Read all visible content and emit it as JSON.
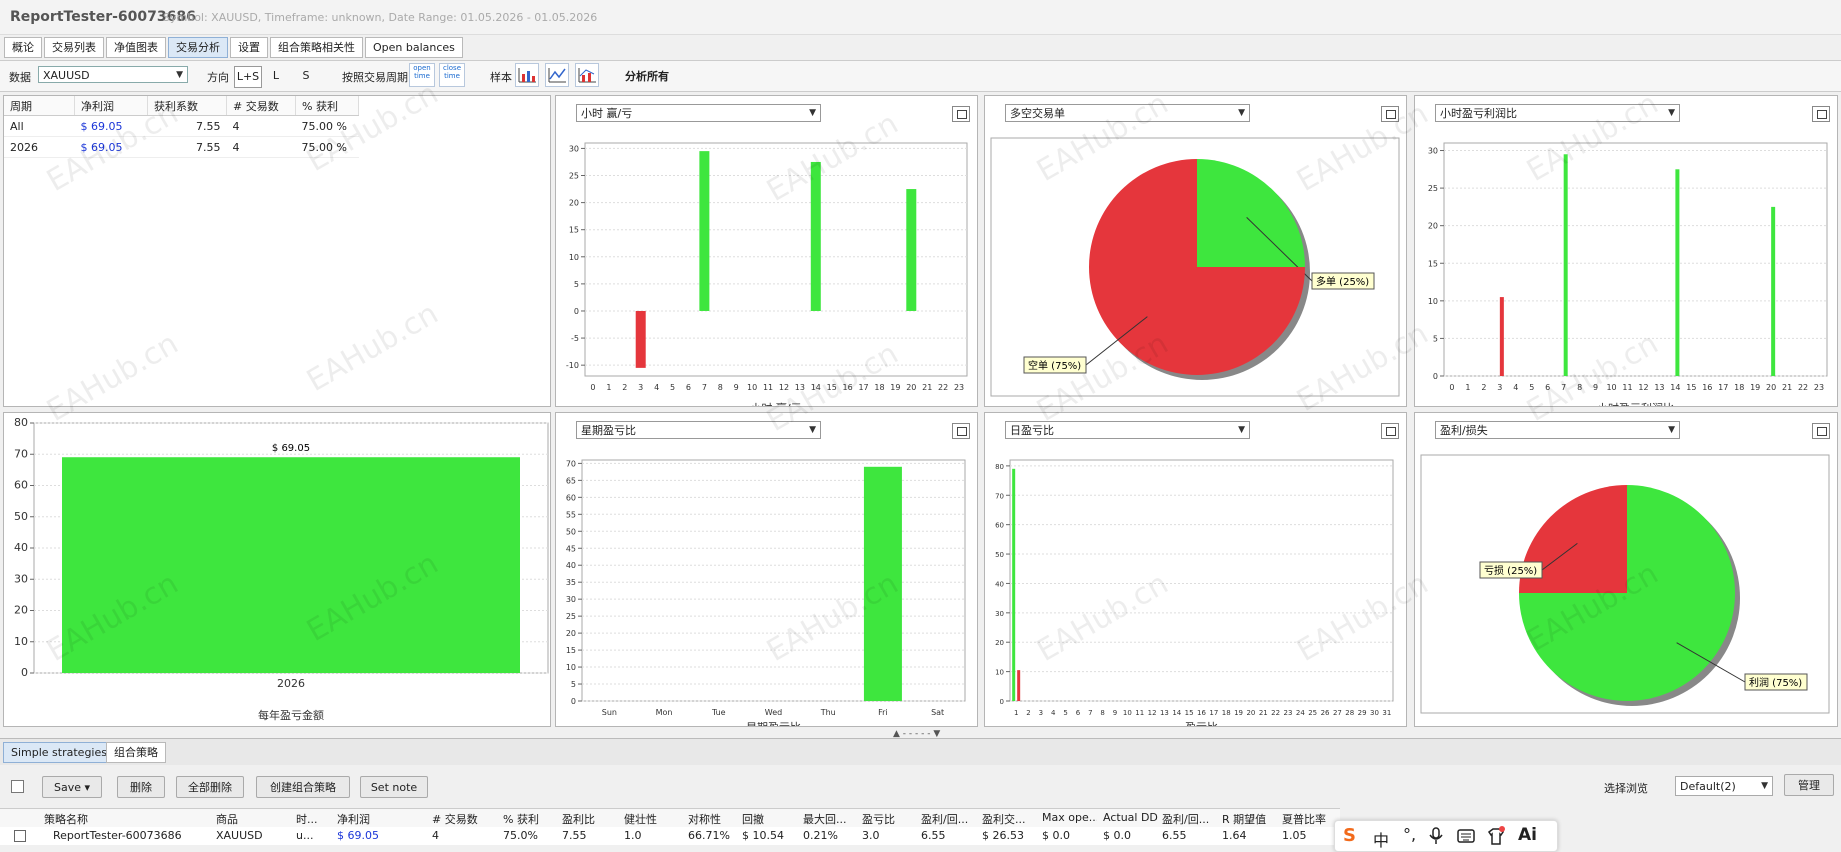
{
  "window": {
    "app_title": "ReportTester-60073686",
    "subtitle": "Symbol: XAUUSD, Timeframe: unknown, Date Range: 01.05.2026 - 01.05.2026"
  },
  "tabs": [
    "概论",
    "交易列表",
    "净值图表",
    "交易分析",
    "设置",
    "组合策略相关性",
    "Open balances"
  ],
  "active_tab": 3,
  "toolbar": {
    "data_label": "数据",
    "data_value": "XAUUSD",
    "direction_label": "方向",
    "dir_ls": "L+S",
    "dir_l": "L",
    "dir_s": "S",
    "by_period_label": "按照交易周期",
    "open_time": "open time",
    "close_time": "close time",
    "sample_label": "样本",
    "analyze_all": "分析所有"
  },
  "stats": {
    "headers": [
      "周期",
      "净利润",
      "获利系数",
      "# 交易数",
      "% 获利"
    ],
    "rows": [
      [
        "All",
        "$ 69.05",
        "7.55",
        "4",
        "75.00 %"
      ],
      [
        "2026",
        "$ 69.05",
        "7.55",
        "4",
        "75.00 %"
      ]
    ]
  },
  "panels": {
    "hourly_select": "小时 赢/亏",
    "long_short_select": "多空交易单",
    "hourly_pl_select": "小时盈亏利润比",
    "weekday_select": "星期盈亏比",
    "daily_select": "日盈亏比",
    "pl_select": "盈利/损失",
    "hourly_xlabel": "小时 赢/亏",
    "hourly_pl_xlabel": "小时盈亏利润比",
    "yearly_xlabel": "每年盈亏金额",
    "weekday_xlabel": "星期盈亏比",
    "daily_xlabel": "盈亏比"
  },
  "colors": {
    "green": "#3ee63e",
    "red": "#e5363c"
  },
  "chart_data": [
    {
      "type": "bar",
      "id": "hourly",
      "categories": [
        "0",
        "1",
        "2",
        "3",
        "4",
        "5",
        "6",
        "7",
        "8",
        "9",
        "10",
        "11",
        "12",
        "13",
        "14",
        "15",
        "16",
        "17",
        "18",
        "19",
        "20",
        "21",
        "22",
        "23"
      ],
      "values": [
        0,
        0,
        0,
        -10.5,
        0,
        0,
        0,
        29.5,
        0,
        0,
        0,
        0,
        0,
        0,
        27.5,
        0,
        0,
        0,
        0,
        0,
        22.5,
        0,
        0,
        0
      ],
      "ylim": [
        -12,
        31
      ],
      "yticks": [
        -10,
        -5,
        0,
        5,
        10,
        15,
        20,
        25,
        30
      ],
      "xlabel": "小时 赢/亏"
    },
    {
      "type": "pie",
      "id": "long_short",
      "slices": [
        {
          "label": "多单 (25%)",
          "value": 25,
          "color": "#3ee63e"
        },
        {
          "label": "空单 (75%)",
          "value": 75,
          "color": "#e5363c"
        }
      ]
    },
    {
      "type": "bar",
      "id": "hourly_pl",
      "categories": [
        "0",
        "1",
        "2",
        "3",
        "4",
        "5",
        "6",
        "7",
        "8",
        "9",
        "10",
        "11",
        "12",
        "13",
        "14",
        "15",
        "16",
        "17",
        "18",
        "19",
        "20",
        "21",
        "22",
        "23"
      ],
      "values": [
        0,
        0,
        0,
        10.5,
        0,
        0,
        0,
        29.5,
        0,
        0,
        0,
        0,
        0,
        0,
        27.5,
        0,
        0,
        0,
        0,
        0,
        22.5,
        0,
        0,
        0
      ],
      "bar_colors": {
        "3": "#e5363c"
      },
      "ylim": [
        0,
        31
      ],
      "yticks": [
        0,
        5,
        10,
        15,
        20,
        25,
        30
      ],
      "xlabel": "小时盈亏利润比"
    },
    {
      "type": "bar",
      "id": "yearly",
      "categories": [
        "2026"
      ],
      "values": [
        69.05
      ],
      "data_labels": [
        "$ 69.05"
      ],
      "ylim": [
        0,
        80
      ],
      "yticks": [
        0,
        10,
        20,
        30,
        40,
        50,
        60,
        70,
        80
      ],
      "xlabel": "每年盈亏金额"
    },
    {
      "type": "bar",
      "id": "weekday",
      "categories": [
        "Sun",
        "Mon",
        "Tue",
        "Wed",
        "Thu",
        "Fri",
        "Sat"
      ],
      "values": [
        0,
        0,
        0,
        0,
        0,
        69,
        0
      ],
      "ylim": [
        0,
        71
      ],
      "yticks": [
        0,
        5,
        10,
        15,
        20,
        25,
        30,
        35,
        40,
        45,
        50,
        55,
        60,
        65,
        70
      ],
      "xlabel": "星期盈亏比"
    },
    {
      "type": "bar",
      "id": "daily",
      "categories": [
        "1",
        "2",
        "3",
        "4",
        "5",
        "6",
        "7",
        "8",
        "9",
        "10",
        "11",
        "12",
        "13",
        "14",
        "15",
        "16",
        "17",
        "18",
        "19",
        "20",
        "21",
        "22",
        "23",
        "24",
        "25",
        "26",
        "27",
        "28",
        "29",
        "30",
        "31"
      ],
      "series": [
        {
          "values": [
            79
          ],
          "color": "#3ee63e"
        },
        {
          "values": [
            10.5
          ],
          "color": "#e5363c"
        }
      ],
      "ylim": [
        0,
        82
      ],
      "yticks": [
        0,
        10,
        20,
        30,
        40,
        50,
        60,
        70,
        80
      ],
      "xlabel": "盈亏比"
    },
    {
      "type": "pie",
      "id": "profit_loss",
      "slices": [
        {
          "label": "亏损 (25%)",
          "value": 25,
          "color": "#e5363c"
        },
        {
          "label": "利润 (75%)",
          "value": 75,
          "color": "#3ee63e"
        }
      ]
    }
  ],
  "bottom": {
    "tab_simple": "Simple strategies",
    "tab_combo": "组合策略",
    "save": "Save ▾",
    "delete": "删除",
    "delete_all": "全部删除",
    "create_combo": "创建组合策略",
    "set_note": "Set note",
    "view_label": "选择浏览",
    "view_value": "Default(2)",
    "manage": "管理",
    "columns": [
      "策略名称",
      "商品",
      "时...",
      "净利润",
      "# 交易数",
      "% 获利",
      "盈利比",
      "健壮性",
      "对称性",
      "回撤",
      "最大回...",
      "盈亏比",
      "盈利/回...",
      "盈利交...",
      "Max ope...",
      "Actual DD",
      "盈利/回...",
      "R 期望值",
      "夏普比率"
    ],
    "row": [
      "ReportTester-60073686",
      "XAUUSD",
      "u...",
      "$ 69.05",
      "4",
      "75.0%",
      "7.55",
      "1.0",
      "66.71%",
      "$ 10.54",
      "0.21%",
      "3.0",
      "6.55",
      "$ 26.53",
      "$ 0.0",
      "$ 0.0",
      "6.55",
      "1.64",
      "1.05"
    ]
  },
  "ime": {
    "icons": [
      "sogou-icon",
      "zh-icon",
      "punct-icon",
      "mic-icon",
      "keyboard-icon",
      "skin-icon",
      "ai-icon"
    ],
    "zh": "中",
    "ai": "Ai"
  },
  "watermark": "EAHub.cn",
  "splitter": "▲ - - - - - ▼"
}
